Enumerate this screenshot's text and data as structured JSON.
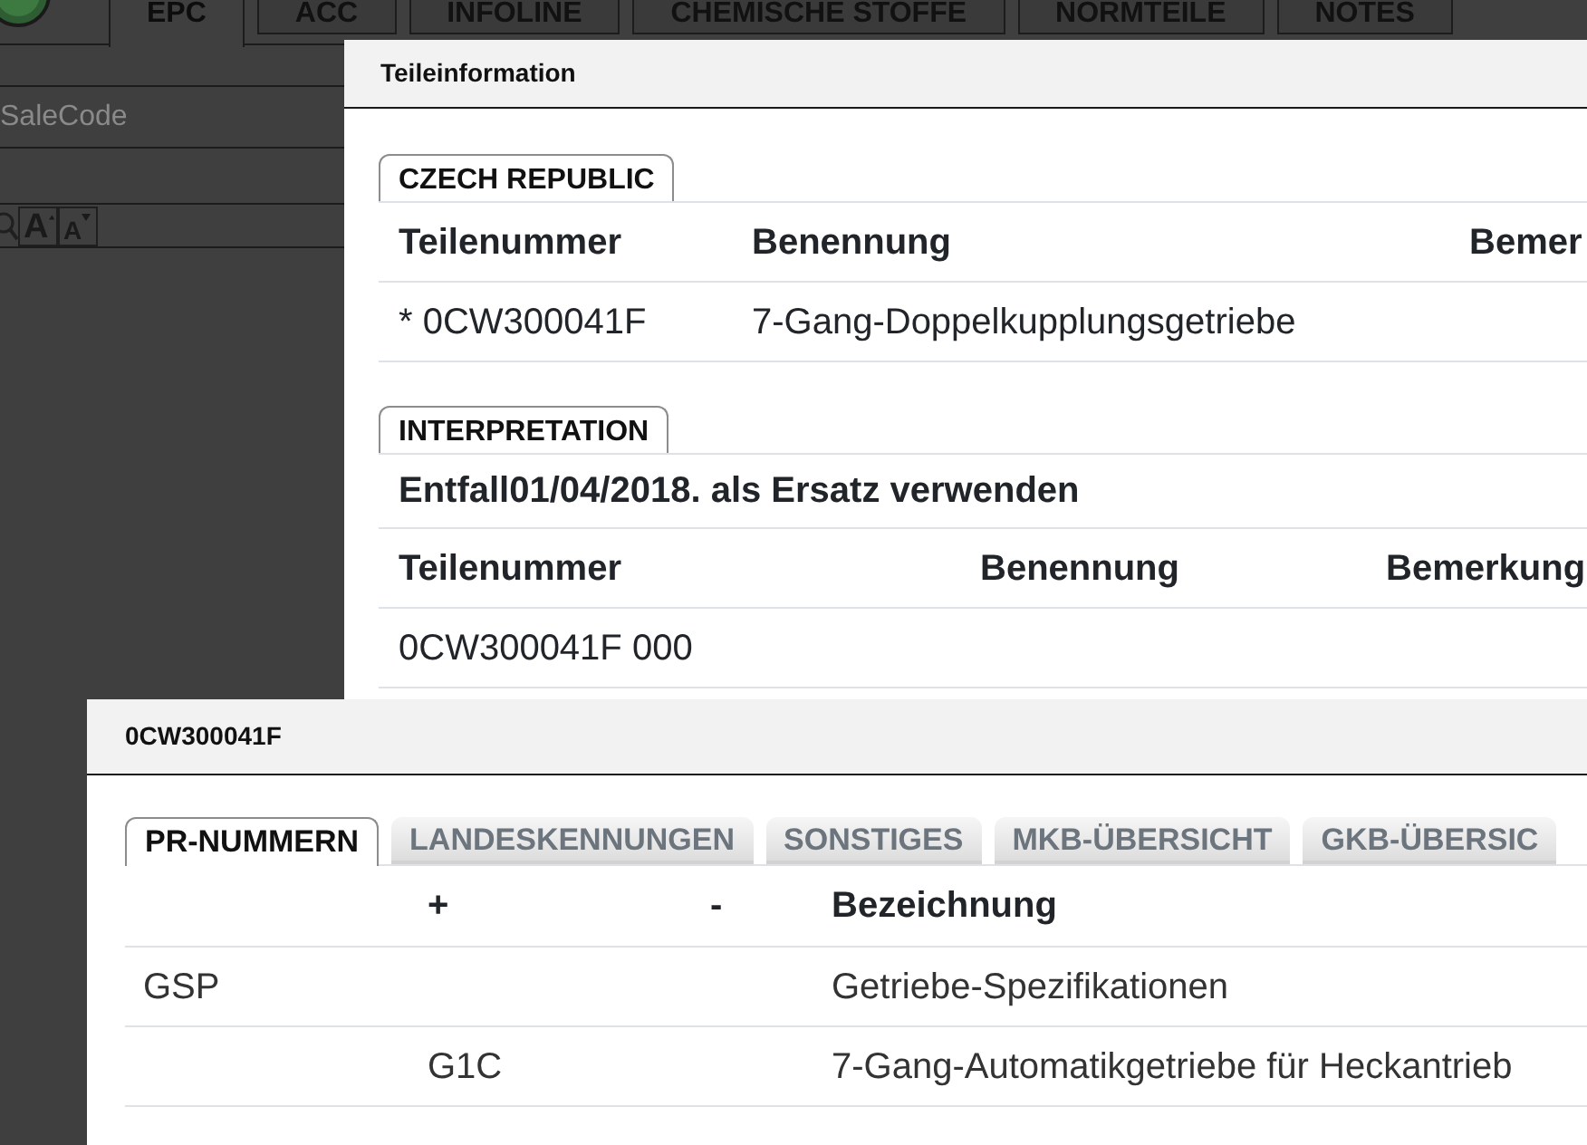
{
  "app": {
    "tabs": [
      {
        "label": "EPC",
        "selected": true
      },
      {
        "label": "ACC",
        "selected": false
      },
      {
        "label": "INFOLINE",
        "selected": false
      },
      {
        "label": "CHEMISCHE STOFFE",
        "selected": false
      },
      {
        "label": "NORMTEILE",
        "selected": false
      },
      {
        "label": "NOTES",
        "selected": false
      }
    ],
    "search": {
      "placeholder": "SaleCode"
    },
    "text_size_buttons": [
      {
        "label": "A",
        "kind": "increase"
      },
      {
        "label": "A",
        "kind": "decrease"
      }
    ]
  },
  "part_info_dialog": {
    "title": "Teileinformation",
    "sections": [
      {
        "heading": "CZECH REPUBLIC",
        "columns": [
          "Teilenummer",
          "Benennung",
          "Bemer"
        ],
        "rows": [
          [
            "* 0CW300041F",
            "7-Gang-Doppelkupplungsgetriebe"
          ]
        ]
      },
      {
        "heading": "INTERPRETATION",
        "note": "Entfall01/04/2018. als Ersatz verwenden",
        "columns": [
          "Teilenummer",
          "Benennung",
          "Bemerkung"
        ],
        "rows": [
          [
            "0CW300041F 000"
          ]
        ]
      }
    ]
  },
  "part_dialog": {
    "title": "0CW300041F",
    "tabs": [
      {
        "label": "PR-NUMMERN",
        "selected": true
      },
      {
        "label": "LANDESKENNUNGEN",
        "selected": false
      },
      {
        "label": "SONSTIGES",
        "selected": false
      },
      {
        "label": "MKB-ÜBERSICHT",
        "selected": false
      },
      {
        "label": "GKB-ÜBERSIC",
        "selected": false
      }
    ],
    "table": {
      "header": {
        "plus": "+",
        "minus": "-",
        "bezeichnung": "Bezeichnung"
      },
      "rows": [
        {
          "column_1": "GSP",
          "bezeichnung": "Getriebe-Spezifikationen"
        },
        {
          "plus": "G1C",
          "bezeichnung": "7-Gang-Automatikgetriebe für Heckantrieb"
        }
      ]
    }
  }
}
